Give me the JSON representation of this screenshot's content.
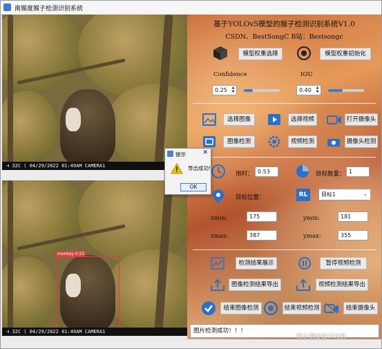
{
  "window": {
    "title": "南猴度猴子检测识别系统"
  },
  "left": {
    "top_pane": {
      "timestamp": "⊣ 32C  ( 04/29/2022  01:49AM  CAMERA1"
    },
    "bottom_pane": {
      "timestamp": "⊣ 32C  ( 04/29/2022  01:49AM  CAMERA1",
      "detection_label": "monkey 0.53"
    }
  },
  "panel": {
    "title": "基于YOLOv5模型的猴子检测识别系统V1.0",
    "subtitle": "CSDN、BestSongC  B站：Bestsongc",
    "model_select_btn": "模型权重选择",
    "model_init_btn": "模型权重初始化",
    "confidence_label": "Confidence",
    "iou_label": "IOU",
    "confidence_value": "0.25",
    "iou_value": "0.40",
    "confidence_level": 0.25,
    "iou_level": 0.4,
    "select_image_btn": "选择图像",
    "select_video_btn": "选择视频",
    "open_camera_btn": "打开摄像头",
    "image_detect_btn": "图像检测",
    "video_detect_btn": "视频检测",
    "camera_detect_btn": "摄像头检测",
    "time_label": "用时：",
    "time_value": "0.53",
    "count_label": "目标数量：",
    "count_value": "1",
    "position_label": "目标位置：",
    "target_select": "目标1",
    "xmin_label": "xmin:",
    "xmin_value": "175",
    "ymin_label": "ymin:",
    "ymin_value": "181",
    "xmax_label": "xmax:",
    "xmax_value": "387",
    "ymax_label": "ymax:",
    "ymax_value": "355",
    "show_results_btn": "检测结果展示",
    "pause_video_btn": "暂停视频检测",
    "export_image_btn": "图像检测结果导出",
    "export_video_btn": "视频检测结果导出",
    "end_image_btn": "结束图像检测",
    "end_video_btn": "结束视频检测",
    "end_camera_btn": "结束摄像头"
  },
  "status": {
    "text": "图片检测成功！！！"
  },
  "watermark": "稀土掘金技术社区",
  "dialog": {
    "title": "提示",
    "message": "导出成功!",
    "ok": "OK",
    "close": "✕"
  },
  "colors": {
    "accent": "#3a7bd5",
    "detect_box": "#e63c3c"
  }
}
